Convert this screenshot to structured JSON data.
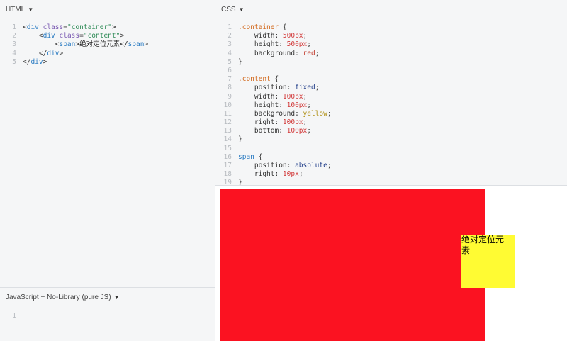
{
  "html_pane": {
    "header": "HTML",
    "lines": [
      {
        "num": "1",
        "segments": [
          {
            "t": "<",
            "c": "t-punct"
          },
          {
            "t": "div",
            "c": "t-tag"
          },
          {
            "t": " ",
            "c": "txt"
          },
          {
            "t": "class",
            "c": "t-attr"
          },
          {
            "t": "=",
            "c": "t-punct"
          },
          {
            "t": "\"container\"",
            "c": "t-str"
          },
          {
            "t": ">",
            "c": "t-punct"
          }
        ]
      },
      {
        "num": "2",
        "segments": [
          {
            "t": "    <",
            "c": "t-punct"
          },
          {
            "t": "div",
            "c": "t-tag"
          },
          {
            "t": " ",
            "c": "txt"
          },
          {
            "t": "class",
            "c": "t-attr"
          },
          {
            "t": "=",
            "c": "t-punct"
          },
          {
            "t": "\"content\"",
            "c": "t-str"
          },
          {
            "t": ">",
            "c": "t-punct"
          }
        ]
      },
      {
        "num": "3",
        "segments": [
          {
            "t": "        <",
            "c": "t-punct"
          },
          {
            "t": "span",
            "c": "t-tag"
          },
          {
            "t": ">绝对定位元素</",
            "c": "txt"
          },
          {
            "t": "span",
            "c": "t-tag"
          },
          {
            "t": ">",
            "c": "t-punct"
          }
        ]
      },
      {
        "num": "4",
        "segments": [
          {
            "t": "    </",
            "c": "t-punct"
          },
          {
            "t": "div",
            "c": "t-tag"
          },
          {
            "t": ">",
            "c": "t-punct"
          }
        ]
      },
      {
        "num": "5",
        "segments": [
          {
            "t": "</",
            "c": "t-punct"
          },
          {
            "t": "div",
            "c": "t-tag"
          },
          {
            "t": ">",
            "c": "t-punct"
          }
        ]
      }
    ]
  },
  "css_pane": {
    "header": "CSS",
    "lines": [
      {
        "num": "1",
        "segments": [
          {
            "t": ".container",
            "c": "t-sel"
          },
          {
            "t": " {",
            "c": "t-punct"
          }
        ]
      },
      {
        "num": "2",
        "segments": [
          {
            "t": "    width: ",
            "c": "t-prop"
          },
          {
            "t": "500px",
            "c": "t-num"
          },
          {
            "t": ";",
            "c": "t-punct"
          }
        ]
      },
      {
        "num": "3",
        "segments": [
          {
            "t": "    height: ",
            "c": "t-prop"
          },
          {
            "t": "500px",
            "c": "t-num"
          },
          {
            "t": ";",
            "c": "t-punct"
          }
        ]
      },
      {
        "num": "4",
        "segments": [
          {
            "t": "    background: ",
            "c": "t-prop"
          },
          {
            "t": "red",
            "c": "t-color-red"
          },
          {
            "t": ";",
            "c": "t-punct"
          }
        ]
      },
      {
        "num": "5",
        "segments": [
          {
            "t": "}",
            "c": "t-punct"
          }
        ]
      },
      {
        "num": "6",
        "segments": [
          {
            "t": "",
            "c": "txt"
          }
        ]
      },
      {
        "num": "7",
        "segments": [
          {
            "t": ".content",
            "c": "t-sel"
          },
          {
            "t": " {",
            "c": "t-punct"
          }
        ]
      },
      {
        "num": "8",
        "segments": [
          {
            "t": "    position: ",
            "c": "t-prop"
          },
          {
            "t": "fixed",
            "c": "t-kw"
          },
          {
            "t": ";",
            "c": "t-punct"
          }
        ]
      },
      {
        "num": "9",
        "segments": [
          {
            "t": "    width: ",
            "c": "t-prop"
          },
          {
            "t": "100px",
            "c": "t-num"
          },
          {
            "t": ";",
            "c": "t-punct"
          }
        ]
      },
      {
        "num": "10",
        "segments": [
          {
            "t": "    height: ",
            "c": "t-prop"
          },
          {
            "t": "100px",
            "c": "t-num"
          },
          {
            "t": ";",
            "c": "t-punct"
          }
        ]
      },
      {
        "num": "11",
        "segments": [
          {
            "t": "    background: ",
            "c": "t-prop"
          },
          {
            "t": "yellow",
            "c": "t-color-yellow"
          },
          {
            "t": ";",
            "c": "t-punct"
          }
        ]
      },
      {
        "num": "12",
        "segments": [
          {
            "t": "    right: ",
            "c": "t-prop"
          },
          {
            "t": "100px",
            "c": "t-num"
          },
          {
            "t": ";",
            "c": "t-punct"
          }
        ]
      },
      {
        "num": "13",
        "segments": [
          {
            "t": "    bottom: ",
            "c": "t-prop"
          },
          {
            "t": "100px",
            "c": "t-num"
          },
          {
            "t": ";",
            "c": "t-punct"
          }
        ]
      },
      {
        "num": "14",
        "segments": [
          {
            "t": "}",
            "c": "t-punct"
          }
        ]
      },
      {
        "num": "15",
        "segments": [
          {
            "t": "",
            "c": "txt"
          }
        ]
      },
      {
        "num": "16",
        "segments": [
          {
            "t": "span",
            "c": "t-tag"
          },
          {
            "t": " {",
            "c": "t-punct"
          }
        ]
      },
      {
        "num": "17",
        "segments": [
          {
            "t": "    position: ",
            "c": "t-prop"
          },
          {
            "t": "absolute",
            "c": "t-kw"
          },
          {
            "t": ";",
            "c": "t-punct"
          }
        ]
      },
      {
        "num": "18",
        "segments": [
          {
            "t": "    right: ",
            "c": "t-prop"
          },
          {
            "t": "10px",
            "c": "t-num"
          },
          {
            "t": ";",
            "c": "t-punct"
          }
        ]
      },
      {
        "num": "19",
        "segments": [
          {
            "t": "}",
            "c": "t-punct"
          }
        ]
      }
    ]
  },
  "js_pane": {
    "header": "JavaScript + No-Library (pure JS)",
    "lines": [
      {
        "num": "1",
        "segments": [
          {
            "t": "",
            "c": "txt"
          }
        ]
      }
    ]
  },
  "preview": {
    "span_text": "绝对定位元素",
    "container_color": "#fb1221",
    "content_color": "#fffb33"
  },
  "icons": {
    "dropdown": "caret-down-icon"
  }
}
